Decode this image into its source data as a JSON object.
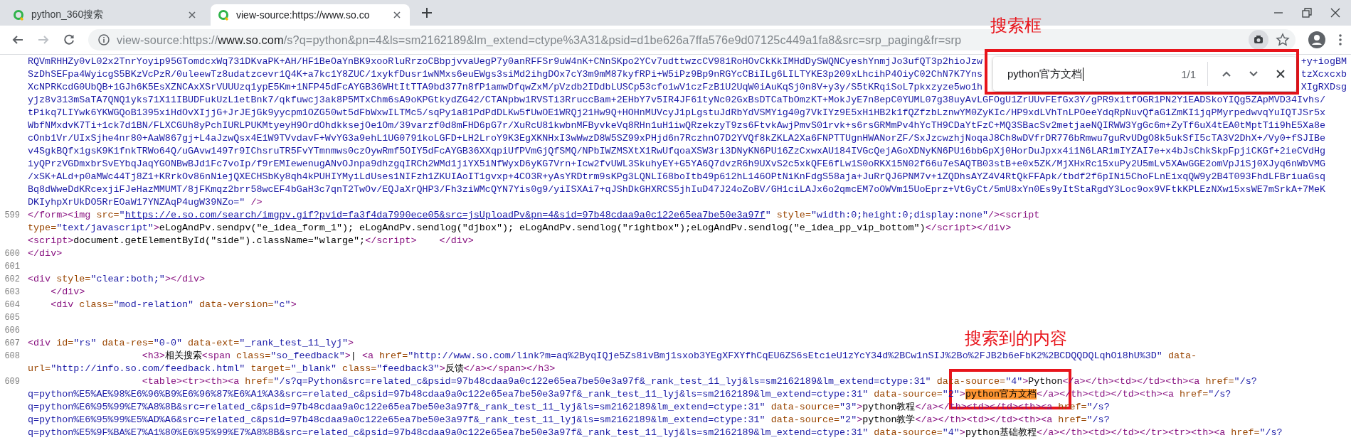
{
  "tabs": [
    {
      "title": "python_360搜索",
      "selected": false
    },
    {
      "title": "view-source:https://www.so.co",
      "selected": true
    }
  ],
  "address_bar": {
    "url": [
      {
        "text": "view-source:https://",
        "emphasis": false
      },
      {
        "text": "www.so.com",
        "emphasis": true
      },
      {
        "text": "/s?q=python&pn=4&ls=sm2162189&lm_extend=ctype%3A31&psid=d1be626a7ffa576e9d07125c449a1fa8&src=srp_paging&fr=srp",
        "emphasis": false
      }
    ]
  },
  "find_bar": {
    "query": "python官方文档",
    "count": "1/1"
  },
  "source_lines": [
    {
      "segments": [
        {
          "kind": "value",
          "text": "RQVmRHHZy0vL02x2TnrYoyip95GTomdcxWq731DKvaPK+AH/HF1BeOaYnBK9xooRluRrzoCBbpjvvaUegP7y0anRFFSr9uW4nK+CNnSKpo2YCv7udttwzcCV981RoHOvCkKkIMHdDySWQNCyeshYnmjJo3ufQT3p2hioJzw"
        }
      ],
      "after_find_bar": [
        {
          "kind": "value",
          "text": "+y+iogBM"
        }
      ]
    },
    {
      "segments": [
        {
          "kind": "value",
          "text": "SzDhSEFpa4WyicgS5BKzVcPzR/0uleewTz8udatzcevr1Q4K+a7kc1Y8ZUC/1xykfDusr1wNMxs6euEWgs3siMd2ihgDOx7cY3m9mM87kyfRPi+W5iPz9Bp9nRGYcCBiILg6LILTYKE3p209xLhcihP4OiyC02ChN7K7Yns"
        }
      ],
      "after_find_bar": [
        {
          "kind": "value",
          "text": "tzXcxcxb"
        }
      ]
    },
    {
      "segments": [
        {
          "kind": "value",
          "text": "XcNPRKcdG0UbQB+1GJh6K5EsXZNCAxXSrVUUUzq1ypE5Km+1NFP45dFcAYGB36WHtItTTA9bd377n8fP1amwDfqwZxM/pVzdb2IDdbLUSCp53cfo1wV1czFzB1U2UqW0iAuKqSj0n8V+y3y/S5tKRqiSoL7pkxzyze5wo1h"
        }
      ],
      "after_find_bar": [
        {
          "kind": "value",
          "text": "XIgRXDsg"
        }
      ]
    },
    {
      "segments": [
        {
          "kind": "value",
          "text": "yjz8v313mSaTA7QNQ1yks71X11IBUDFukUzL1etBnk7/qkfuwcj3ak8P5MTxChm6sA9oKPGtkydZG42/CTANpbw1RVSTi3RruccBam+2EHbY7v5IR4JF61tyNc02GxBsDTCaTbOmzKT+MokJyE7n8epC0YUML07g38uyAvLGFOgU1ZrUUvFEfGx3Y/gPR9xitfOGR1PN2Y1EADSkoYIQg5ZApMVD34Ivhs/"
        }
      ]
    },
    {
      "segments": [
        {
          "kind": "value",
          "text": "tPikq7LIYwk6YKWGQoB1395xiHdOvXIjjG+JrJEjGk9yycpm1OZG50wt5dFbWxwILTMc5/sqPy1a81PdPdDLKw5fUwOE1WRQj21Hw9Q+HOHnMUVcyJ1pLgstuJdRbYdVSMYig40g7VkIYz9E5xHiHB2k1fQZfzbLznwYM0ZyKIc/HP9xdLVhTnLPOeeYdqRpNuvQfaG1ZmKI1jqPMyrpedwvqYuIQTJSr5x"
        }
      ]
    },
    {
      "segments": [
        {
          "kind": "value",
          "text": "WbfNMxdvK7Ti+1ck7d1BN/FLXCGUh8yPchIURLPUKMtyeyH9OrdOhdkksejOe1Om/39varzf0d8mFHD6pG7r/XuRcU81kwbnMFByvkeVq8RHn1uH1iwQRzekzyT9zs6FtvkAwjPmvS01rvk+s6rsGRMmPv4hYcTH9CDaYtFzC+MQ3SBacSv2metjaeNQIRWW3YgGc6m+ZyTf6uX4tEA0tMptT1i9hE5Xa8e"
        }
      ]
    },
    {
      "segments": [
        {
          "kind": "value",
          "text": "cOnb1Vr/UIxSjhe4nr80+AaW867gj+L4aJzwQsx4E1W9TVvdavF+WvYG3a9ehL1UG0791koLGFD+LH2LroY9K3EgXKNHxI3wWwzD8W5SZ99xPHjd6n7RczhnO7D2YVQf8kZKLA2Xa6FNPTTUgnHWANorZF/SxJzcwzhjNoqaJ8Ch8wDVfrDR776bRmwu7guRvUDgO8k5ukSfI5cTA3V2DhX+/Vy0+fSJIBe"
        }
      ]
    },
    {
      "segments": [
        {
          "kind": "value",
          "text": "v4SgkBQfx1gsK9K1fnkTRWo64Q/uGAvw1497r9IChsruTR5FvYTmnmws0czOywRmf5OIY5dFcAYGB36XXqpiUfPVmGjQfSMQ/NPbIWZMSXtX1RwUfqoaXSW3ri3DNyKN6PU16ZzCxwxAU184IVGcQejAGoXDNyKN6PU16bbGpXj0HorDuJpxx4i1N6LAR1mIYZAI7e+x4bJsChkSkpFpjiCKGf+2ieCVdHg"
        }
      ]
    },
    {
      "segments": [
        {
          "kind": "value",
          "text": "iyQPrzVGDmxbrSvEYbqJaqYGONBwBJd1Fc7voIp/f9rEMIewenugANvOJnpa9dhzgqIRCh2WMd1jiYX5iNfWyxD6yKG7Vrn+Icw2fvUWL3SkuhyEY+G5YA6Q7dvzR6h9UXvS2c5xkQFE6fLw1S0oRKX15N02f66u7eSAQTB03stB+e0x5ZK/MjXHxRc15xuPy2U5mLv5XAwGGE2omVpJiSj0XJyq6nWbVMG"
        }
      ]
    },
    {
      "segments": [
        {
          "kind": "value",
          "text": "/xSK+ALd+p0aMWc44Tj8Z1+KRrkOv86nNiejQXECHSbKy8qh4kPUHIYMyiLdUses1NIFzh1ZKUIAoIT1gvxp+4CO3R+yAsYRDtrm9sKPg3LQNLI68boItb49p612hL146OPtNiKnFdgS58aja+JuRrQJ6PNM7v+iZQDhsAYZ4V4RtQkFFApk/tbdf2f6pINi5ChoFLnEixqQW9y2B4T093FhdLFBriuaGsq"
        }
      ]
    },
    {
      "segments": [
        {
          "kind": "value",
          "text": "Bq8dWweDdKRcexjiFJeHazMMUMT/8jFKmqz2brr58wcEF4bGaH3c7qnT2TwOv/EQJaXrQHP3/Fh3ziWMcQYN7Yis0g9/yiISXAi7+qJShDkGHXRCS5jhIuD47J24oZoBV/GH1ciLAJx6o2qmcEM7oOWVm15UoEprz+VtGyCt/5mU8xYn0Es9yItStaRgdY3Loc9ox9VFtkKPLEzNXw15xsWE7mSrkA+7MeK"
        }
      ]
    },
    {
      "segments": [
        {
          "kind": "value",
          "text": "DKIyhpXrUkDO5RrEOaW17YNZAqP4ugW39NZo=\""
        },
        {
          "kind": "tag",
          "text": " />"
        }
      ]
    },
    {
      "number": "599",
      "segments": [
        {
          "kind": "tag",
          "text": "</form><img "
        },
        {
          "kind": "attr",
          "text": "src="
        },
        {
          "kind": "value",
          "text": "\""
        },
        {
          "kind": "link",
          "text": "https://e.so.com/search/imgpv.gif?pvid=fa3f4da7990ece05&src=jsUploadPv&pn=4&sid=97b48cdaa9a0c122e65ea7be50e3a97f"
        },
        {
          "kind": "value",
          "text": "\""
        },
        {
          "kind": "attr",
          "text": " style="
        },
        {
          "kind": "value",
          "text": "\"width:0;height:0;display:none\""
        },
        {
          "kind": "tag",
          "text": "/><script"
        }
      ]
    },
    {
      "segments": [
        {
          "kind": "attr",
          "text": "type="
        },
        {
          "kind": "value",
          "text": "\"text/javascript\""
        },
        {
          "kind": "tag",
          "text": ">"
        },
        {
          "kind": "text",
          "text": "eLogAndPv.sendpv(\"e_idea_form_1\"); eLogAndPv.sendlog(\"djbox\"); eLogAndPv.sendlog(\"rightbox\");eLogAndPv.sendlog(\"e_idea_pp_vip_bottom\")"
        },
        {
          "kind": "tag",
          "text": "</script></div>"
        }
      ]
    },
    {
      "segments": [
        {
          "kind": "tag",
          "text": "<script>"
        },
        {
          "kind": "text",
          "text": "document.getElementById(\"side\").className=\"wlarge\";"
        },
        {
          "kind": "tag",
          "text": "</script>"
        },
        {
          "kind": "tag",
          "text": "    </div>"
        }
      ]
    },
    {
      "number": "600",
      "segments": [
        {
          "kind": "tag",
          "text": "</div>"
        }
      ]
    },
    {
      "number": "601"
    },
    {
      "number": "602",
      "segments": [
        {
          "kind": "tag",
          "text": "<div "
        },
        {
          "kind": "attr",
          "text": "style="
        },
        {
          "kind": "value",
          "text": "\"clear:both;\""
        },
        {
          "kind": "tag",
          "text": "></div>"
        }
      ]
    },
    {
      "number": "603",
      "segments": [
        {
          "kind": "tag",
          "text": "    </div>"
        }
      ]
    },
    {
      "number": "604",
      "segments": [
        {
          "kind": "tag",
          "text": "    <div "
        },
        {
          "kind": "attr",
          "text": "class="
        },
        {
          "kind": "value",
          "text": "\"mod-relation\""
        },
        {
          "kind": "attr",
          "text": " data-version="
        },
        {
          "kind": "value",
          "text": "\"c\""
        },
        {
          "kind": "tag",
          "text": ">"
        }
      ]
    },
    {
      "number": "605"
    },
    {
      "number": "606"
    },
    {
      "number": "607",
      "segments": [
        {
          "kind": "tag",
          "text": "<div "
        },
        {
          "kind": "attr",
          "text": "id="
        },
        {
          "kind": "value",
          "text": "\"rs\""
        },
        {
          "kind": "attr",
          "text": " data-res="
        },
        {
          "kind": "value",
          "text": "\"0-0\""
        },
        {
          "kind": "attr",
          "text": " data-ext="
        },
        {
          "kind": "value",
          "text": "\"_rank_test_11_lyj\""
        },
        {
          "kind": "tag",
          "text": ">"
        }
      ]
    },
    {
      "number": "608",
      "segments": [
        {
          "kind": "tag",
          "text": "                    <h3>"
        },
        {
          "kind": "text",
          "text": "相关搜索"
        },
        {
          "kind": "tag",
          "text": "<span "
        },
        {
          "kind": "attr",
          "text": "class="
        },
        {
          "kind": "value",
          "text": "\"so_feedback\""
        },
        {
          "kind": "tag",
          "text": ">"
        },
        {
          "kind": "text",
          "text": "| "
        },
        {
          "kind": "tag",
          "text": "<a "
        },
        {
          "kind": "attr",
          "text": "href="
        },
        {
          "kind": "value",
          "text": "\"http://www.so.com/link?m=aq%2ByqIQje5Zs8ivBmj1sxob3YEgXFXYfhCqEU6ZS6sEtcieU1zYcY34d%2BCw1nSIJ%2Bo%2FJB2b6eFbK2%2BCDQQDQLqhOi8hU%3D\""
        },
        {
          "kind": "attr",
          "text": " data-"
        }
      ]
    },
    {
      "segments": [
        {
          "kind": "attr",
          "text": "url="
        },
        {
          "kind": "value",
          "text": "\"http://info.so.com/feedback.html\""
        },
        {
          "kind": "attr",
          "text": " target="
        },
        {
          "kind": "value",
          "text": "\"_blank\""
        },
        {
          "kind": "attr",
          "text": " class="
        },
        {
          "kind": "value",
          "text": "\"feedback3\""
        },
        {
          "kind": "tag",
          "text": ">"
        },
        {
          "kind": "text",
          "text": "反馈"
        },
        {
          "kind": "tag",
          "text": "</a></span></h3>"
        }
      ]
    },
    {
      "number": "609",
      "segments": [
        {
          "kind": "tag",
          "text": "                    <table><tr><th><a "
        },
        {
          "kind": "attr",
          "text": "href="
        },
        {
          "kind": "value",
          "text": "\"/s?q=Python&src=related_c&psid=97b48cdaa9a0c122e65ea7be50e3a97f&_rank_test_11_lyj&ls=sm2162189&lm_extend=ctype:31\""
        },
        {
          "kind": "attr",
          "text": " data-source="
        },
        {
          "kind": "value",
          "text": "\"4\""
        },
        {
          "kind": "tag",
          "text": ">"
        },
        {
          "kind": "text",
          "text": "Python"
        },
        {
          "kind": "tag",
          "text": "</a></th><td></td><th><a "
        },
        {
          "kind": "attr",
          "text": "href="
        },
        {
          "kind": "value",
          "text": "\"/s?"
        }
      ]
    },
    {
      "segments": [
        {
          "kind": "value",
          "text": "q=python%E5%AE%98%E6%96%B9%E6%96%87%E6%A1%A3&src=related_c&psid=97b48cdaa9a0c122e65ea7be50e3a97f&_rank_test_11_lyj&ls=sm2162189&lm_extend=ctype:31\""
        },
        {
          "kind": "attr",
          "text": " data-source="
        },
        {
          "kind": "value",
          "text": "\"2\""
        },
        {
          "kind": "tag",
          "text": ">"
        },
        {
          "kind": "match",
          "text": "python官方文档"
        },
        {
          "kind": "tag",
          "text": "</a></th><td></td><th><a "
        },
        {
          "kind": "attr",
          "text": "href="
        },
        {
          "kind": "value",
          "text": "\"/s?"
        }
      ]
    },
    {
      "segments": [
        {
          "kind": "value",
          "text": "q=python%E6%95%99%E7%A8%8B&src=related_c&psid=97b48cdaa9a0c122e65ea7be50e3a97f&_rank_test_11_lyj&ls=sm2162189&lm_extend=ctype:31\""
        },
        {
          "kind": "attr",
          "text": " data-source="
        },
        {
          "kind": "value",
          "text": "\"3\""
        },
        {
          "kind": "tag",
          "text": ">"
        },
        {
          "kind": "text",
          "text": "python教程"
        },
        {
          "kind": "tag",
          "text": "</a></th><td></td><th><a "
        },
        {
          "kind": "attr",
          "text": "href="
        },
        {
          "kind": "value",
          "text": "\"/s?"
        }
      ]
    },
    {
      "segments": [
        {
          "kind": "value",
          "text": "q=python%E6%95%99%E5%AD%A6&src=related_c&psid=97b48cdaa9a0c122e65ea7be50e3a97f&_rank_test_11_lyj&ls=sm2162189&lm_extend=ctype:31\""
        },
        {
          "kind": "attr",
          "text": " data-source="
        },
        {
          "kind": "value",
          "text": "\"2\""
        },
        {
          "kind": "tag",
          "text": ">"
        },
        {
          "kind": "text",
          "text": "python教学"
        },
        {
          "kind": "tag",
          "text": "</a></th><td></td><th><a "
        },
        {
          "kind": "attr",
          "text": "href="
        },
        {
          "kind": "value",
          "text": "\"/s?"
        }
      ]
    },
    {
      "segments": [
        {
          "kind": "value",
          "text": "q=python%E5%9F%BA%E7%A1%80%E6%95%99%E7%A8%8B&src=related_c&psid=97b48cdaa9a0c122e65ea7be50e3a97f&_rank_test_11_lyj&ls=sm2162189&lm_extend=ctype:31\""
        },
        {
          "kind": "attr",
          "text": " data-source="
        },
        {
          "kind": "value",
          "text": "\"4\""
        },
        {
          "kind": "tag",
          "text": ">"
        },
        {
          "kind": "text",
          "text": "python基础教程"
        },
        {
          "kind": "tag",
          "text": "</a></th><td></td></tr><tr><th><a "
        },
        {
          "kind": "attr",
          "text": "href="
        },
        {
          "kind": "value",
          "text": "\"/s?"
        }
      ]
    }
  ],
  "annotations": [
    {
      "label": "搜索框"
    },
    {
      "label": "搜索到的内容"
    }
  ]
}
